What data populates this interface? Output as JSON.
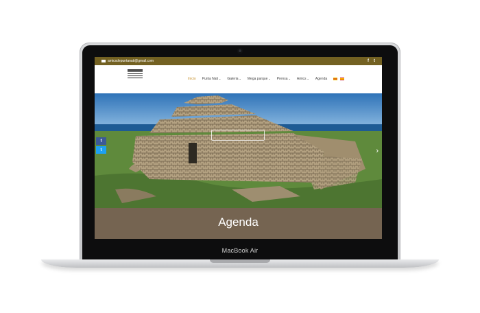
{
  "device": {
    "brand": "MacBook Air"
  },
  "topbar": {
    "email": "amicsdepuntanati@gmail.com",
    "social": [
      {
        "name": "facebook",
        "glyph": "f"
      },
      {
        "name": "twitter",
        "glyph": "t"
      }
    ]
  },
  "logo": {
    "text": "AMICS PUNTA NATI"
  },
  "menu": {
    "items": [
      {
        "label": "Inicio",
        "active": true
      },
      {
        "label": "Punta Nati"
      },
      {
        "label": "Galeria"
      },
      {
        "label": "Mega parque"
      },
      {
        "label": "Prensa"
      },
      {
        "label": "Amics"
      },
      {
        "label": "Agenda"
      }
    ],
    "caret": "⌄",
    "flags": [
      "catalan-flag",
      "spanish-flag"
    ]
  },
  "share": {
    "facebook": "f",
    "twitter": "t"
  },
  "hero": {
    "next_arrow": "›"
  },
  "band": {
    "title": "Agenda"
  },
  "colors": {
    "topbar": "#736122",
    "band": "#756451",
    "active_menu": "#c7922e"
  }
}
